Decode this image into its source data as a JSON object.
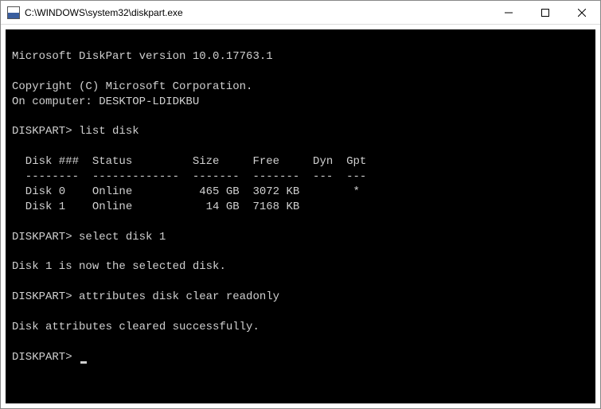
{
  "window": {
    "title": "C:\\WINDOWS\\system32\\diskpart.exe"
  },
  "terminal": {
    "blank0": "",
    "version": "Microsoft DiskPart version 10.0.17763.1",
    "blank1": "",
    "copyright": "Copyright (C) Microsoft Corporation.",
    "computer": "On computer: DESKTOP-LDIDKBU",
    "blank2": "",
    "prompt1": "DISKPART> ",
    "cmd1": "list disk",
    "blank3": "",
    "table_header": "  Disk ###  Status         Size     Free     Dyn  Gpt",
    "table_sep": "  --------  -------------  -------  -------  ---  ---",
    "disk0": "  Disk 0    Online          465 GB  3072 KB        *",
    "disk1": "  Disk 1    Online           14 GB  7168 KB",
    "blank4": "",
    "prompt2": "DISKPART> ",
    "cmd2": "select disk 1",
    "blank5": "",
    "msg1": "Disk 1 is now the selected disk.",
    "blank6": "",
    "prompt3": "DISKPART> ",
    "cmd3": "attributes disk clear readonly",
    "blank7": "",
    "msg2": "Disk attributes cleared successfully.",
    "blank8": "",
    "prompt4": "DISKPART> "
  }
}
